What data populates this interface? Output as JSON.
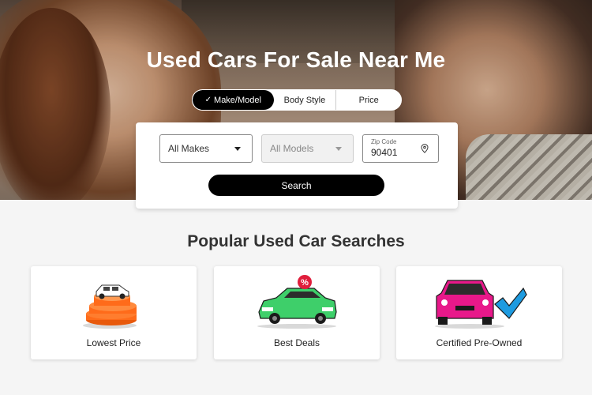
{
  "hero": {
    "title": "Used Cars For Sale Near Me"
  },
  "tabs": [
    {
      "label": "Make/Model",
      "active": true
    },
    {
      "label": "Body Style",
      "active": false
    },
    {
      "label": "Price",
      "active": false
    }
  ],
  "search": {
    "makes_value": "All Makes",
    "models_value": "All Models",
    "zip_label": "Zip Code",
    "zip_value": "90401",
    "button_label": "Search"
  },
  "popular": {
    "title": "Popular Used Car Searches",
    "cards": [
      {
        "label": "Lowest Price",
        "icon": "coins-car-icon"
      },
      {
        "label": "Best Deals",
        "icon": "discount-car-icon"
      },
      {
        "label": "Certified Pre-Owned",
        "icon": "certified-car-icon"
      }
    ]
  },
  "colors": {
    "accent_black": "#000000",
    "coin_orange": "#ff6b1a",
    "deal_green": "#3ecf6a",
    "certified_pink": "#e8188a",
    "check_blue": "#1e9be0"
  }
}
